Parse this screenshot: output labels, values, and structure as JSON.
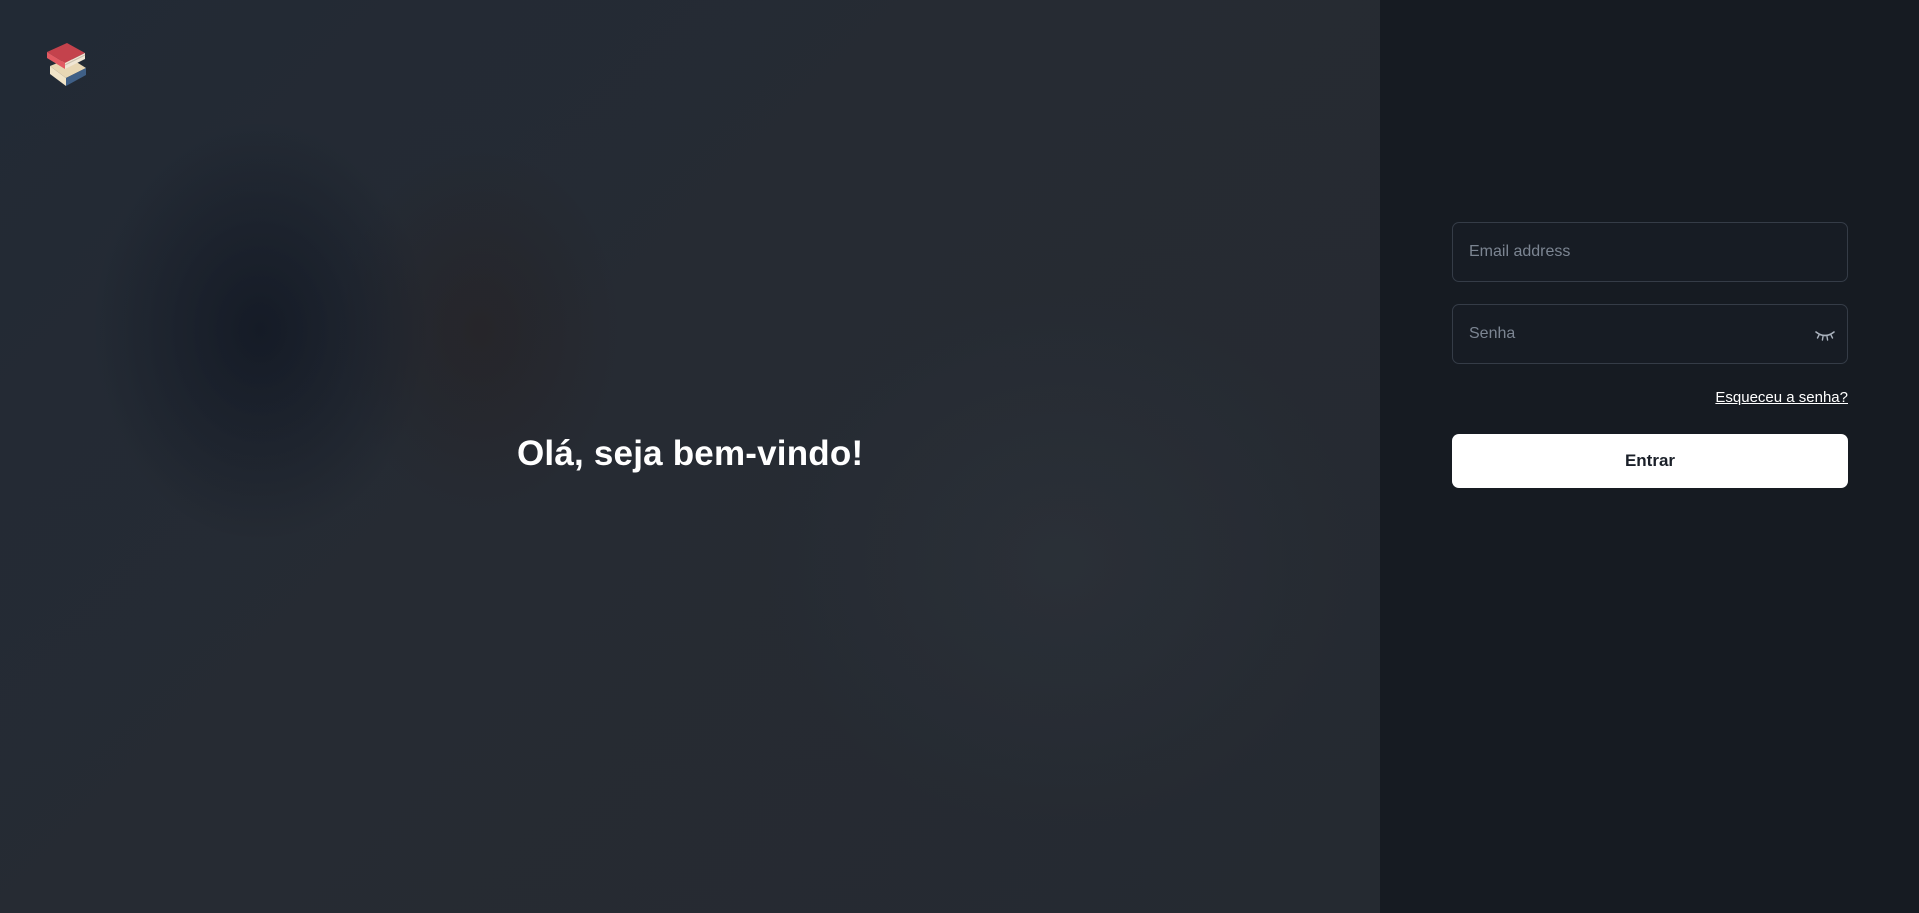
{
  "hero": {
    "logo_icon": "stacked-books-icon",
    "title": "Olá, seja bem-vindo!"
  },
  "login": {
    "email": {
      "placeholder": "Email address",
      "value": ""
    },
    "password": {
      "placeholder": "Senha",
      "value": "",
      "toggle_icon": "eye-closed-icon"
    },
    "forgot_label": "Esqueceu a senha?",
    "submit_label": "Entrar"
  },
  "colors": {
    "hero_background": "#242a33",
    "panel_background": "#161b22",
    "field_border": "#353c47",
    "button_background": "#ffffff",
    "button_text": "#1b2029",
    "text_primary": "#ffffff",
    "placeholder": "#7c8592"
  }
}
